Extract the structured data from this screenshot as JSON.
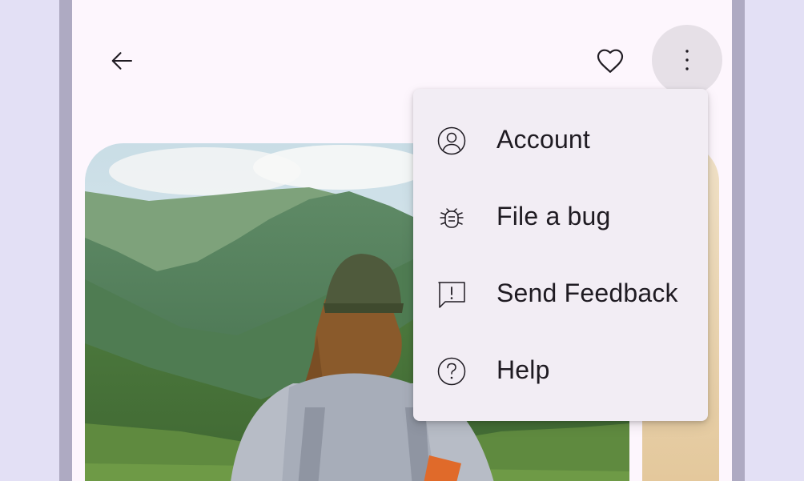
{
  "toolbar": {
    "back_icon": "arrow-back-icon",
    "favorite_icon": "heart-outline-icon",
    "more_icon": "more-vert-icon"
  },
  "menu": {
    "items": [
      {
        "label": "Account",
        "icon": "account-circle-icon"
      },
      {
        "label": "File a bug",
        "icon": "bug-icon"
      },
      {
        "label": "Send Feedback",
        "icon": "feedback-icon"
      },
      {
        "label": "Help",
        "icon": "help-circle-icon"
      }
    ]
  },
  "colors": {
    "page_background": "#e3e0f5",
    "screen_background": "#fdf6fd",
    "menu_background": "#f2edf4",
    "more_button_highlight": "#e6e0e7",
    "text": "#1f1b22"
  }
}
